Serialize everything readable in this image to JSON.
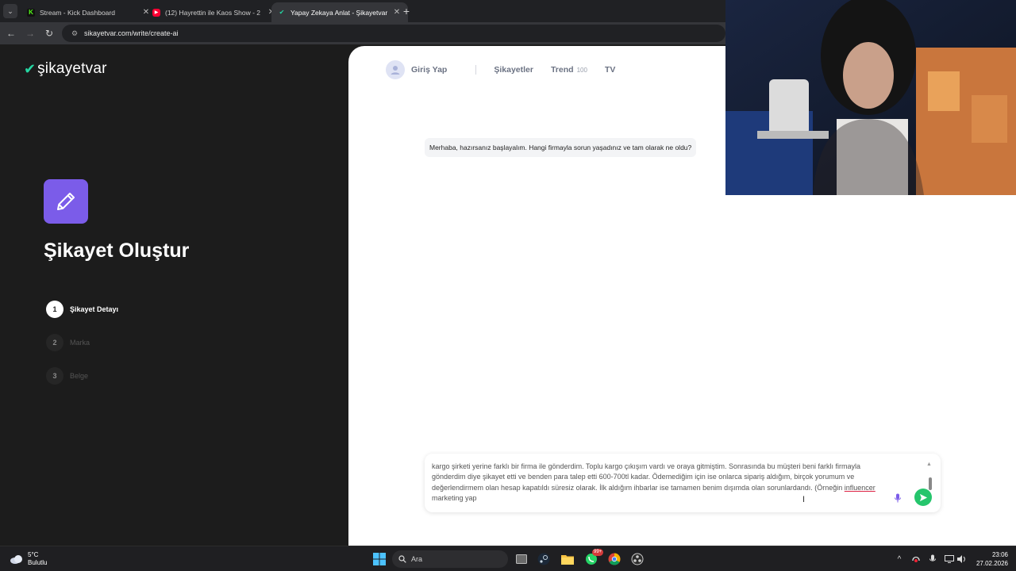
{
  "browser": {
    "tabs": [
      {
        "title": "Stream - Kick Dashboard",
        "favicon": "kick-icon",
        "color": "#53fc18"
      },
      {
        "title": "(12) Hayrettin ile Kaos Show - 2",
        "favicon": "youtube-icon",
        "color": "#ff0033"
      },
      {
        "title": "Yapay Zekaya Anlat - Şikayetvar",
        "favicon": "sikayetvar-icon",
        "color": "#25d6a2"
      }
    ],
    "active_tab": 2,
    "url": "sikayetvar.com/write/create-ai"
  },
  "site": {
    "logo": "şikayetvar",
    "brand_color": "#25d6a2",
    "accent_color": "#7b5ce9",
    "title": "Şikayet Oluştur",
    "steps": [
      {
        "num": "1",
        "label": "Şikayet Detayı",
        "state": "current"
      },
      {
        "num": "2",
        "label": "Marka",
        "state": "pending"
      },
      {
        "num": "3",
        "label": "Belge",
        "state": "pending"
      }
    ],
    "nav": {
      "login": "Giriş Yap",
      "complaints": "Şikayetler",
      "trend": "Trend",
      "trend_count": "100",
      "tv": "TV"
    },
    "bot_message": "Merhaba, hazırsanız başlayalım. Hangi firmayla sorun yaşadınız ve tam olarak ne oldu?",
    "composer": {
      "before": "kargo şirketi yerine farklı bir firma ile gönderdim. Toplu kargo çıkışım vardı ve oraya gitmiştim. Sonrasında bu müşteri beni farklı firmayla gönderdim diye şikayet etti ve benden para talep etti 600-700tl kadar. Ödemediğim için ise onlarca sipariş aldığım, birçok yorumum ve değerlendirmem olan hesap kapatıldı süresiz olarak. İlk aldığım ihbarlar ise tamamen benim dışımda olan sorunlardandı. (Örneğin ",
      "underlined": "influencer",
      "after": " marketing yap",
      "send_color": "#25c56c"
    }
  },
  "taskbar": {
    "weather_temp": "5°C",
    "weather_desc": "Bulutlu",
    "search_placeholder": "Ara",
    "whatsapp_badge": "99+",
    "time": "23:06",
    "date": "27.02.2026"
  }
}
